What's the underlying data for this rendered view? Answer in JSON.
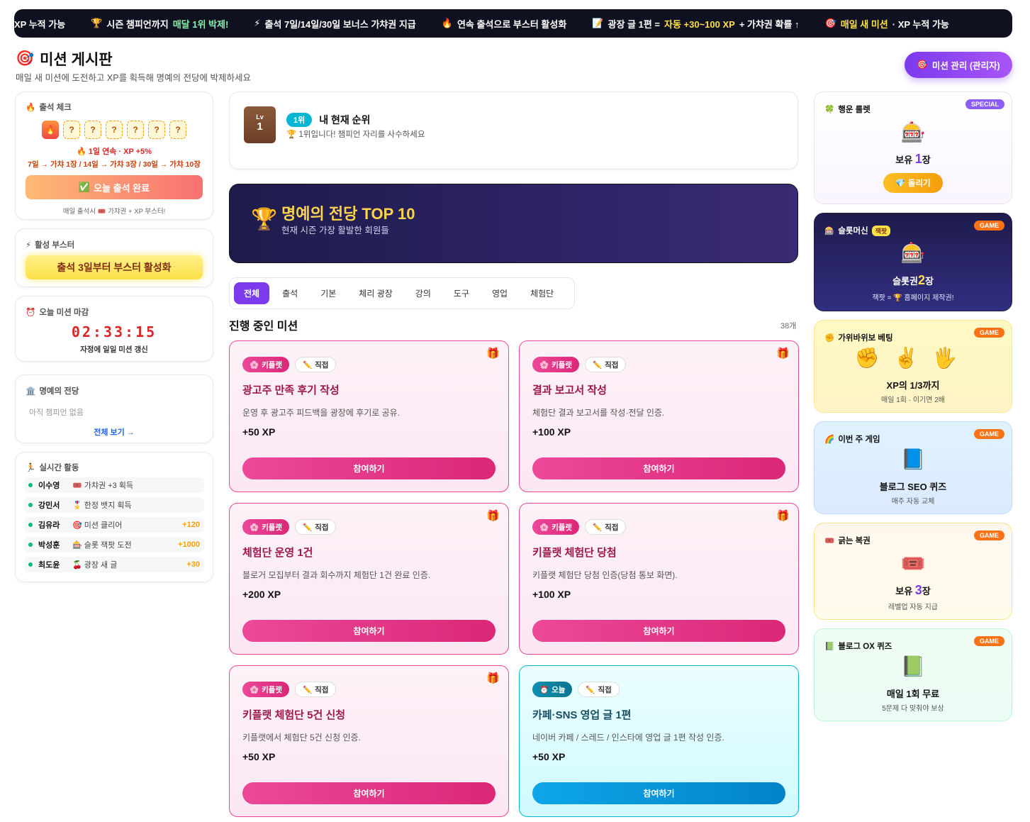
{
  "ticker": [
    {
      "icon": "",
      "pre": "XP 누적 가능",
      "hl": "",
      "hl2": ""
    },
    {
      "icon": "🏆",
      "pre": "시즌 챔피언까지",
      "hl": "",
      "hl2": "매달 1위 박제!"
    },
    {
      "icon": "⚡",
      "pre": "출석 7일/14일/30일 보너스 가챠권 지급",
      "hl": "",
      "hl2": ""
    },
    {
      "icon": "🔥",
      "pre": "연속 출석으로 부스터 활성화",
      "hl": "",
      "hl2": ""
    },
    {
      "icon": "📝",
      "pre": "광장 글 1편 =",
      "hl": "자동 +30~100 XP",
      "post": "+ 가챠권 확률 ↑",
      "hl2": ""
    },
    {
      "icon": "🎯",
      "pre": "",
      "hl": "매일 새 미션",
      "post": "· XP 누적 가능",
      "hl2": ""
    }
  ],
  "header": {
    "icon": "🎯",
    "title": "미션 게시판",
    "subtitle": "매일 새 미션에 도전하고 XP를 획득해 명예의 전당에 박제하세요",
    "admin_button": "미션 관리 (관리자)"
  },
  "attendance": {
    "title": "출석 체크",
    "days": [
      "🔥",
      "?",
      "?",
      "?",
      "?",
      "?",
      "?"
    ],
    "streak": "1일 연속 · XP +5%",
    "rules": "7일 → 가챠 1장 / 14일 → 가챠 3장 / 30일 → 가챠 10장",
    "button": "오늘 출석 완료",
    "footer": "매일 출석시 🎟️ 가챠권 + XP 부스터!"
  },
  "booster": {
    "title": "활성 부스터",
    "button": "출석 3일부터 부스터 활성화"
  },
  "deadline": {
    "title": "오늘 미션 마감",
    "timer": "02:33:15",
    "sub": "자정에 일일 미션 갱신"
  },
  "hall": {
    "title": "명예의 전당",
    "empty": "아직 챔피언 없음",
    "link": "전체 보기 →"
  },
  "activity": {
    "title": "실시간 활동",
    "rows": [
      {
        "name": "이수영",
        "icon": "🎟️",
        "action": "가챠권 +3 획득",
        "xp": ""
      },
      {
        "name": "강민서",
        "icon": "🎖️",
        "action": "한정 뱃지 획득",
        "xp": ""
      },
      {
        "name": "김유라",
        "icon": "🎯",
        "action": "미션 클리어",
        "xp": "+120"
      },
      {
        "name": "박성훈",
        "icon": "🎰",
        "action": "슬롯 잭팟 도전",
        "xp": "+1000"
      },
      {
        "name": "최도윤",
        "icon": "🍒",
        "action": "광장 새 글",
        "xp": "+30"
      }
    ]
  },
  "my_rank": {
    "lv_label": "Lv",
    "level": "1",
    "rank": "1위",
    "title": "내 현재 순위",
    "sub": "1위입니다! 챔피언 자리를 사수하세요"
  },
  "hof": {
    "title": "명예의 전당 TOP 10",
    "sub": "현재 시즌 가장 활발한 회원들"
  },
  "tabs": [
    "전체",
    "출석",
    "기본",
    "체리 광장",
    "강의",
    "도구",
    "영업",
    "체험단"
  ],
  "section": {
    "title": "진행 중인 미션",
    "count": "38개"
  },
  "missions": [
    {
      "tag": "키플랫",
      "tag2": "직접",
      "title": "광고주 만족 후기 작성",
      "desc": "운영 후 광고주 피드백을 광장에 후기로 공유.",
      "xp": "+50 XP",
      "button": "참여하기"
    },
    {
      "tag": "키플랫",
      "tag2": "직접",
      "title": "결과 보고서 작성",
      "desc": "체험단 결과 보고서를 작성·전달 인증.",
      "xp": "+100 XP",
      "button": "참여하기"
    },
    {
      "tag": "키플랫",
      "tag2": "직접",
      "title": "체험단 운영 1건",
      "desc": "블로거 모집부터 결과 회수까지 체험단 1건 완료 인증.",
      "xp": "+200 XP",
      "button": "참여하기"
    },
    {
      "tag": "키플랫",
      "tag2": "직접",
      "title": "키플랫 체험단 당첨",
      "desc": "키플랫 체험단 당첨 인증(당첨 통보 화면).",
      "xp": "+100 XP",
      "button": "참여하기"
    },
    {
      "tag": "키플랫",
      "tag2": "직접",
      "title": "키플랫 체험단 5건 신청",
      "desc": "키플랫에서 체험단 5건 신청 인증.",
      "xp": "+50 XP",
      "button": "참여하기"
    },
    {
      "tag": "오늘",
      "tag2": "직접",
      "title": "카페·SNS 영업 글 1편",
      "desc": "네이버 카페 / 스레드 / 인스타에 영업 글 1편 작성 인증.",
      "xp": "+50 XP",
      "button": "참여하기"
    }
  ],
  "right": {
    "roulette": {
      "title": "행운 룰렛",
      "badge": "SPECIAL",
      "pre": "보유",
      "num": "1",
      "post": "장",
      "button": "💎 돌리기"
    },
    "slot": {
      "title": "슬롯머신",
      "jackpot": "잭팟",
      "badge": "GAME",
      "pre": "슬롯권",
      "num": "2",
      "post": "장",
      "sub": "잭팟 = 🏆 홈페이지 제작권!"
    },
    "rps": {
      "title": "가위바위보 베팅",
      "badge": "GAME",
      "main": "XP의 1/3까지",
      "sub": "매일 1회 · 이기면 2배"
    },
    "weekly": {
      "title": "이번 주 게임",
      "badge": "GAME",
      "main": "블로그 SEO 퀴즈",
      "sub": "매주 자동 교체"
    },
    "scratch": {
      "title": "긁는 복권",
      "badge": "GAME",
      "pre": "보유",
      "num": "3",
      "post": "장",
      "sub": "레벨업 자동 지급"
    },
    "ox": {
      "title": "블로그 OX 퀴즈",
      "badge": "GAME",
      "main": "매일 1회 무료",
      "sub": "5문제 다 맞춰야 보상"
    }
  },
  "colors": {
    "accent": "#7c3aed",
    "pink": "#ec4899",
    "cyan": "#06b6d4",
    "orange": "#f59e0b"
  }
}
